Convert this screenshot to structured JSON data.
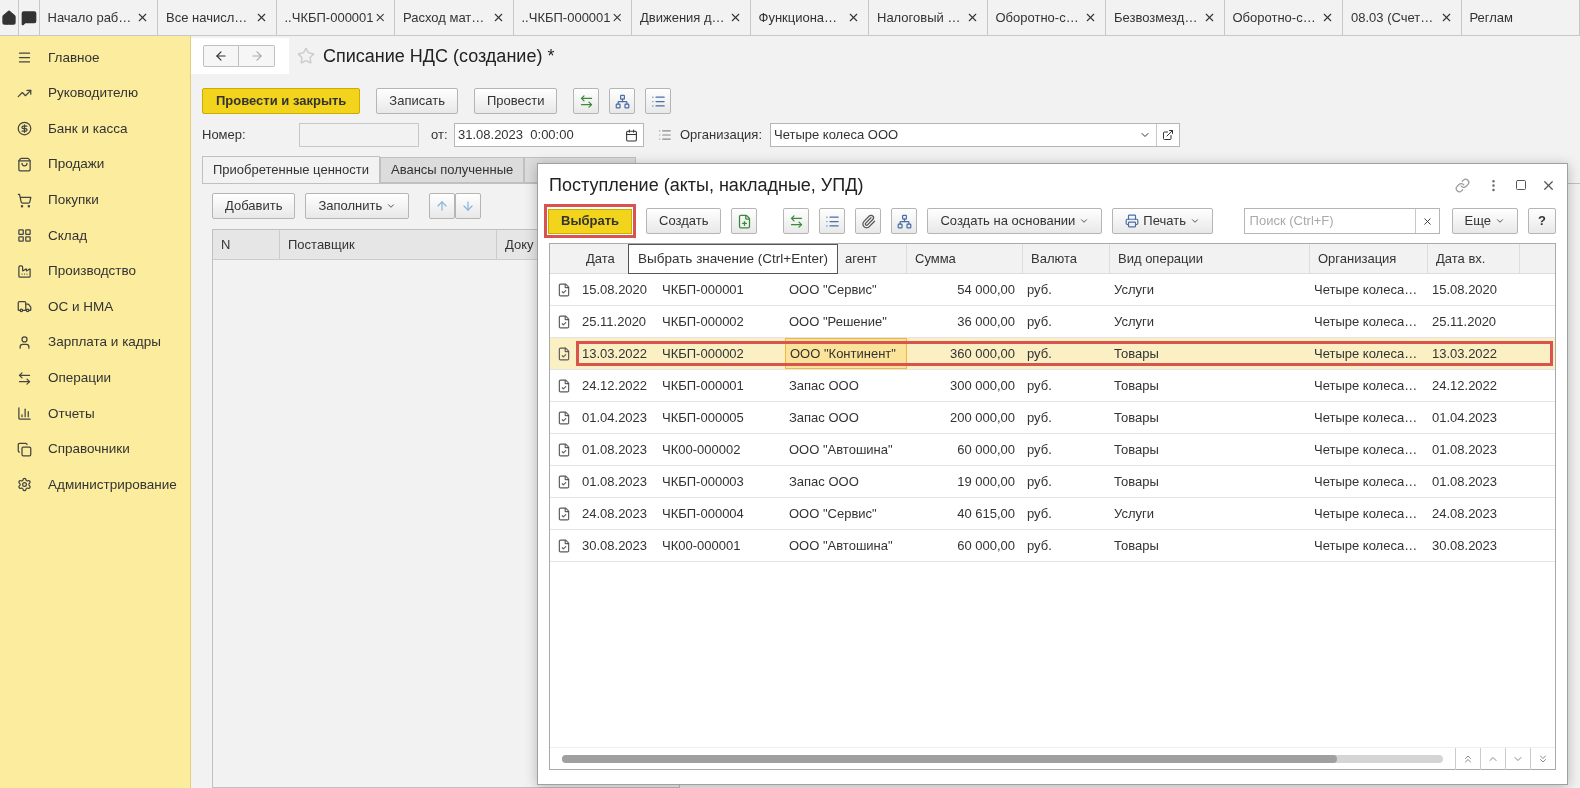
{
  "open_tabs": [
    {
      "label": "Начало раб…",
      "closable": true
    },
    {
      "label": "Все начисл…",
      "closable": true
    },
    {
      "label": "..ЧКБП-000001",
      "closable": true
    },
    {
      "label": "Расход мат…",
      "closable": true
    },
    {
      "label": "..ЧКБП-000001",
      "closable": true
    },
    {
      "label": "Движения д…",
      "closable": true
    },
    {
      "label": "Функциона…",
      "closable": true
    },
    {
      "label": "Налоговый …",
      "closable": true
    },
    {
      "label": "Оборотно-с…",
      "closable": true
    },
    {
      "label": "Безвозмезд…",
      "closable": true
    },
    {
      "label": "Оборотно-с…",
      "closable": true
    },
    {
      "label": "08.03 (Счет…",
      "closable": true
    },
    {
      "label": "Реглам",
      "closable": false
    }
  ],
  "sidebar": {
    "items": [
      {
        "label": "Главное"
      },
      {
        "label": "Руководителю"
      },
      {
        "label": "Банк и касса"
      },
      {
        "label": "Продажи"
      },
      {
        "label": "Покупки"
      },
      {
        "label": "Склад"
      },
      {
        "label": "Производство"
      },
      {
        "label": "ОС и НМА"
      },
      {
        "label": "Зарплата и кадры"
      },
      {
        "label": "Операции"
      },
      {
        "label": "Отчеты"
      },
      {
        "label": "Справочники"
      },
      {
        "label": "Администрирование"
      }
    ]
  },
  "form": {
    "title": "Списание НДС (создание) *",
    "buttons": [
      {
        "label": "Провести и закрыть",
        "kind": "primary"
      },
      {
        "label": "Записать",
        "kind": "default"
      },
      {
        "label": "Провести",
        "kind": "default"
      }
    ],
    "number": {
      "label": "Номер:"
    },
    "date": {
      "label": "от:",
      "value": "31.08.2023  0:00:00"
    },
    "organization": {
      "label": "Организация:",
      "value": "Четыре колеса ООО"
    },
    "tabs": [
      {
        "label": "Приобретенные ценности",
        "selected": true
      },
      {
        "label": "Авансы полученные",
        "selected": false
      },
      {
        "selected": false
      }
    ],
    "toolbar": [
      {
        "label": "Добавить",
        "dropdown": false
      },
      {
        "label": "Заполнить",
        "dropdown": true
      }
    ],
    "table": {
      "columns": [
        "N",
        "Поставщик",
        "Доку"
      ]
    }
  },
  "dialog": {
    "title": "Поступление (акты, накладные, УПД)",
    "select_button": {
      "label": "Выбрать",
      "annotated": true
    },
    "create_button": "Создать",
    "based_on_button": "Создать на основании",
    "print_button": "Печать",
    "search": {
      "placeholder": "Поиск (Ctrl+F)"
    },
    "more_button": "Еще",
    "help_button": "?",
    "tooltip": "Выбрать значение (Ctrl+Enter)",
    "table": {
      "columns": [
        {
          "label": "Дата"
        },
        {},
        {
          "label": "агент"
        },
        {
          "label": "Сумма"
        },
        {
          "label": "Валюта"
        },
        {
          "label": "Вид операции"
        },
        {
          "label": "Организация"
        },
        {
          "label": "Дата вх."
        }
      ],
      "rows": [
        {
          "cells": [
            "15.08.2020",
            "ЧКБП-000001",
            "ООО \"Сервис\"",
            "54 000,00",
            "руб.",
            "Услуги",
            "Четыре колеса…",
            "15.08.2020"
          ],
          "selected": false,
          "annotated": false
        },
        {
          "cells": [
            "25.11.2020",
            "ЧКБП-000002",
            "ООО \"Решение\"",
            "36 000,00",
            "руб.",
            "Услуги",
            "Четыре колеса…",
            "25.11.2020"
          ],
          "selected": false,
          "annotated": false
        },
        {
          "cells": [
            "13.03.2022",
            "ЧКБП-000002",
            "ООО \"Континент\"",
            "360 000,00",
            "руб.",
            "Товары",
            "Четыре колеса…",
            "13.03.2022"
          ],
          "selected": true,
          "annotated": true
        },
        {
          "cells": [
            "24.12.2022",
            "ЧКБП-000001",
            "Запас ООО",
            "300 000,00",
            "руб.",
            "Товары",
            "Четыре колеса…",
            "24.12.2022"
          ],
          "selected": false,
          "annotated": false
        },
        {
          "cells": [
            "01.04.2023",
            "ЧКБП-000005",
            "Запас ООО",
            "200 000,00",
            "руб.",
            "Товары",
            "Четыре колеса…",
            "01.04.2023"
          ],
          "selected": false,
          "annotated": false
        },
        {
          "cells": [
            "01.08.2023",
            "ЧК00-000002",
            "ООО \"Автошина\"",
            "60 000,00",
            "руб.",
            "Товары",
            "Четыре колеса…",
            "01.08.2023"
          ],
          "selected": false,
          "annotated": false
        },
        {
          "cells": [
            "01.08.2023",
            "ЧКБП-000003",
            "Запас ООО",
            "19 000,00",
            "руб.",
            "Товары",
            "Четыре колеса…",
            "01.08.2023"
          ],
          "selected": false,
          "annotated": false
        },
        {
          "cells": [
            "24.08.2023",
            "ЧКБП-000004",
            "ООО \"Сервис\"",
            "40 615,00",
            "руб.",
            "Услуги",
            "Четыре колеса…",
            "24.08.2023"
          ],
          "selected": false,
          "annotated": false
        },
        {
          "cells": [
            "30.08.2023",
            "ЧК00-000001",
            "ООО \"Автошина\"",
            "60 000,00",
            "руб.",
            "Товары",
            "Четыре колеса…",
            "30.08.2023"
          ],
          "selected": false,
          "annotated": false
        }
      ]
    }
  }
}
